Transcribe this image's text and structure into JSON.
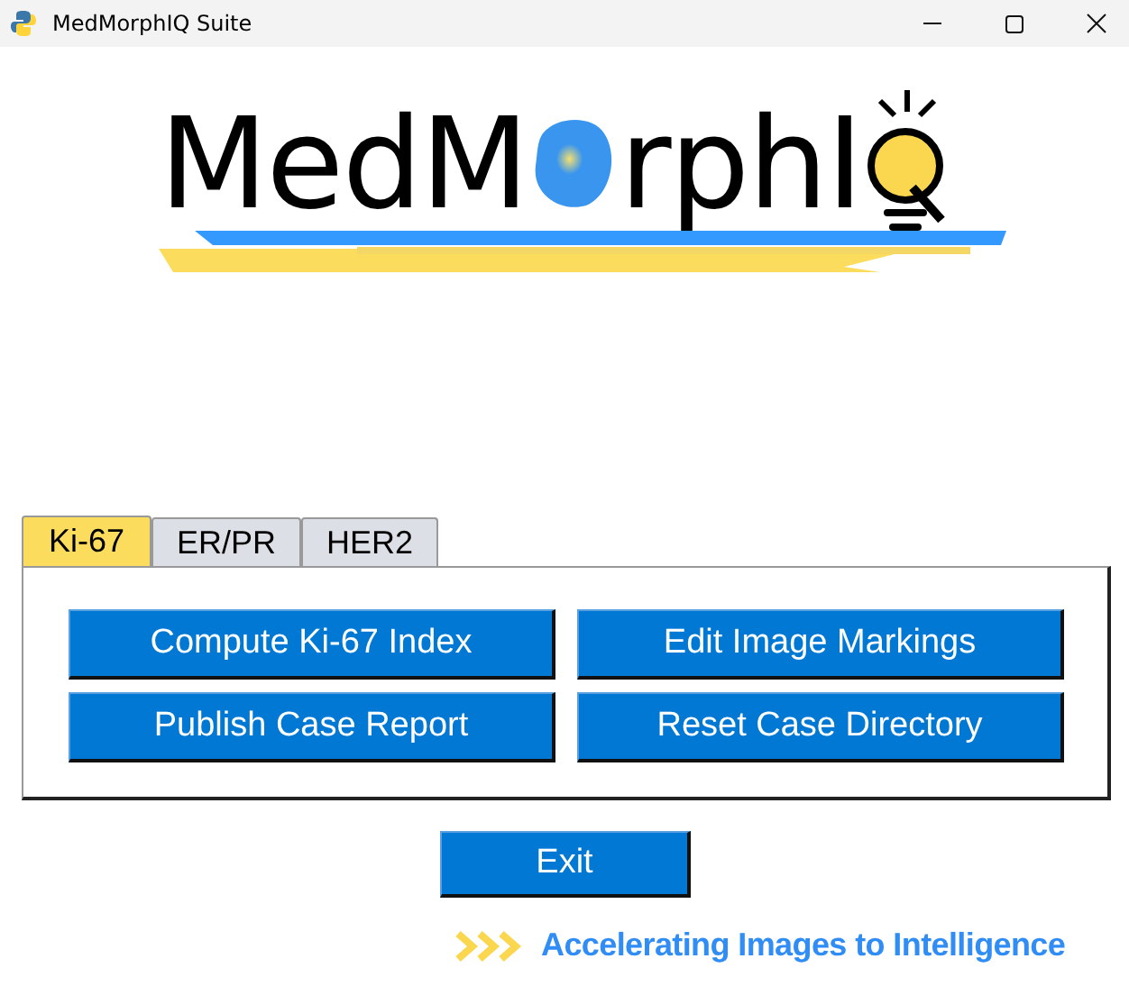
{
  "window": {
    "title": "MedMorphIQ Suite"
  },
  "logo": {
    "text_before": "MedM",
    "text_after": "rphI"
  },
  "tabs": [
    {
      "label": "Ki-67",
      "selected": true
    },
    {
      "label": "ER/PR",
      "selected": false
    },
    {
      "label": "HER2",
      "selected": false
    }
  ],
  "actions": [
    {
      "label": "Compute Ki-67 Index"
    },
    {
      "label": "Edit Image Markings"
    },
    {
      "label": "Publish Case Report"
    },
    {
      "label": "Reset Case Directory"
    }
  ],
  "exit_button": {
    "label": "Exit"
  },
  "tagline": "Accelerating Images to Intelligence"
}
